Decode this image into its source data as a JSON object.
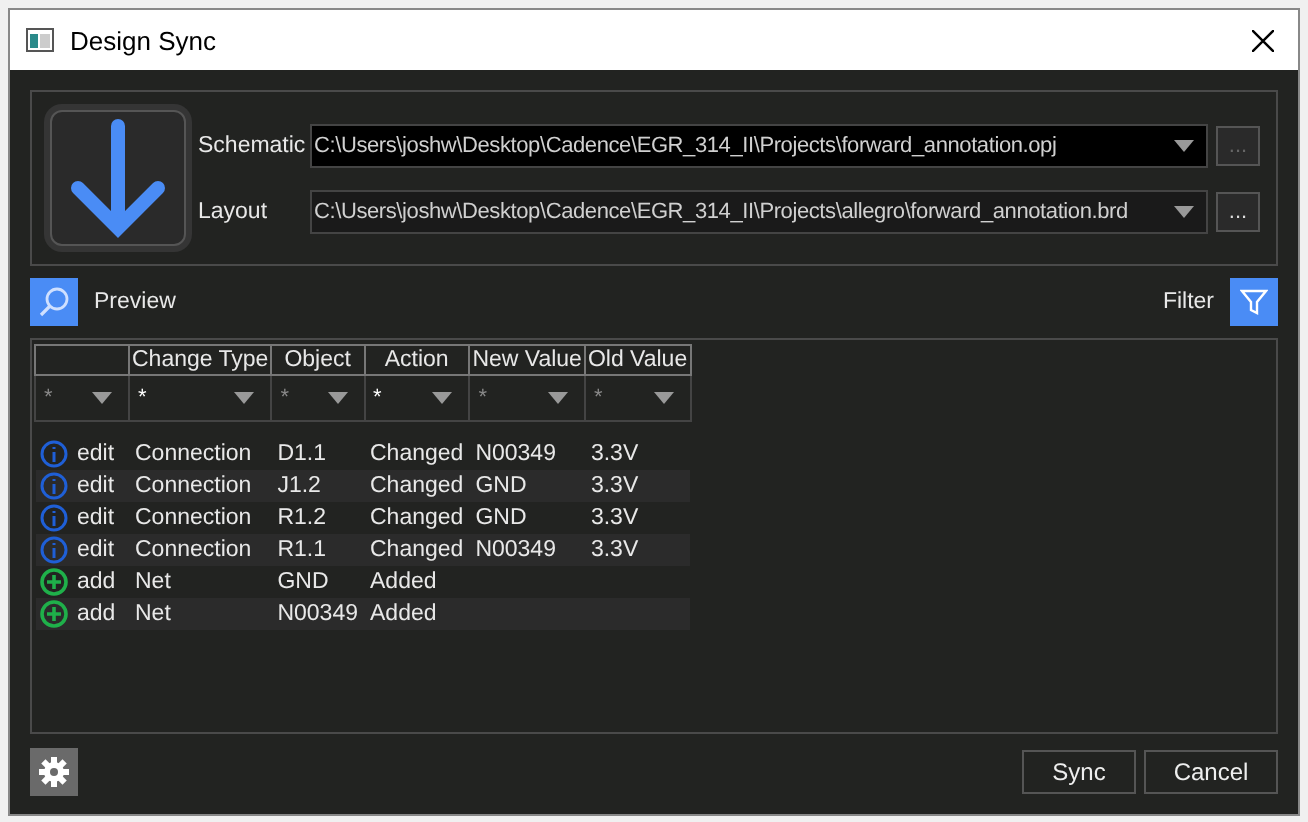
{
  "window": {
    "title": "Design Sync"
  },
  "paths": [
    {
      "label": "Schematic",
      "value": "C:\\Users\\joshw\\Desktop\\Cadence\\EGR_314_II\\Projects\\forward_annotation.opj",
      "browse": "...",
      "browse_disabled": true
    },
    {
      "label": "Layout",
      "value": "C:\\Users\\joshw\\Desktop\\Cadence\\EGR_314_II\\Projects\\allegro\\forward_annotation.brd",
      "browse": "...",
      "browse_disabled": false
    }
  ],
  "preview": {
    "label": "Preview"
  },
  "filter": {
    "label": "Filter"
  },
  "table": {
    "columns": [
      "",
      "Change Type",
      "Object",
      "Action",
      "New Value",
      "Old Value"
    ],
    "filters": [
      {
        "value": "*",
        "active": false
      },
      {
        "value": "*",
        "active": true
      },
      {
        "value": "*",
        "active": false
      },
      {
        "value": "*",
        "active": true
      },
      {
        "value": "*",
        "active": false
      },
      {
        "value": "*",
        "active": false
      }
    ],
    "rows": [
      {
        "kind": "edit",
        "cells": [
          "edit",
          "Connection",
          "D1.1",
          "Changed",
          "N00349",
          "3.3V"
        ]
      },
      {
        "kind": "edit",
        "cells": [
          "edit",
          "Connection",
          "J1.2",
          "Changed",
          "GND",
          "3.3V"
        ]
      },
      {
        "kind": "edit",
        "cells": [
          "edit",
          "Connection",
          "R1.2",
          "Changed",
          "GND",
          "3.3V"
        ]
      },
      {
        "kind": "edit",
        "cells": [
          "edit",
          "Connection",
          "R1.1",
          "Changed",
          "N00349",
          "3.3V"
        ]
      },
      {
        "kind": "add",
        "cells": [
          "add",
          "Net",
          "GND",
          "Added",
          "",
          ""
        ]
      },
      {
        "kind": "add",
        "cells": [
          "add",
          "Net",
          "N00349",
          "Added",
          "",
          ""
        ]
      }
    ]
  },
  "buttons": [
    "Sync",
    "Cancel"
  ]
}
